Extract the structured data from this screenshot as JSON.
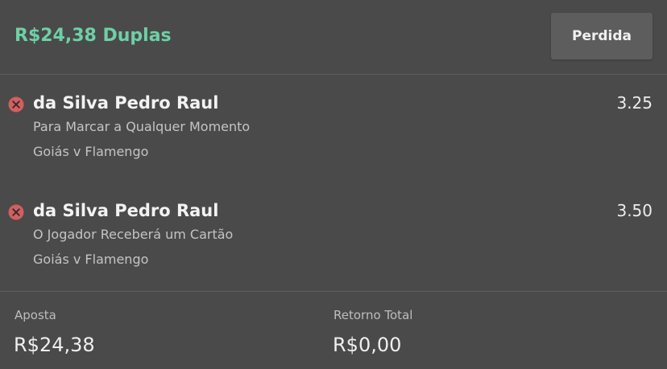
{
  "header": {
    "title": "R$24,38 Duplas",
    "title_color": "#6fcfa6",
    "status_label": "Perdida"
  },
  "selections": [
    {
      "name": "da Silva Pedro Raul",
      "odds": "3.25",
      "market": "Para Marcar a Qualquer Momento",
      "event": "Goiás v Flamengo",
      "result_icon": "x-circle-icon"
    },
    {
      "name": "da Silva Pedro Raul",
      "odds": "3.50",
      "market": "O Jogador Receberá um Cartão",
      "event": "Goiás v Flamengo",
      "result_icon": "x-circle-icon"
    }
  ],
  "summary": {
    "stake_label": "Aposta",
    "stake_value": "R$24,38",
    "return_label": "Retorno Total",
    "return_value": "R$0,00"
  },
  "colors": {
    "background": "#4a4a4a",
    "lost_icon": "#d35f5f"
  }
}
